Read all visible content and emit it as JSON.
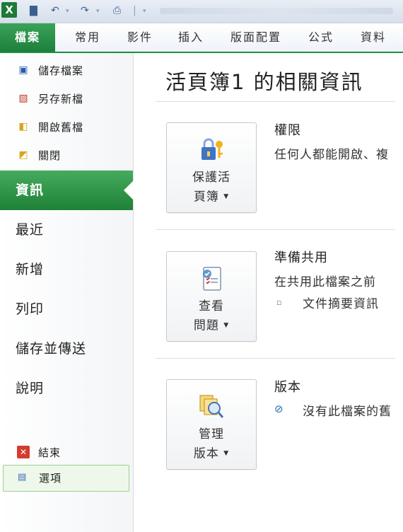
{
  "qat": {
    "logo": "X",
    "save_icon": "save-icon",
    "undo_icon": "undo-icon",
    "redo_icon": "redo-icon",
    "print_icon": "print-icon"
  },
  "tabs": [
    "檔案",
    "常用",
    "插入",
    "版面配置",
    "公式",
    "資料"
  ],
  "tabs_display": {
    "home": "常用",
    "insert": "插入",
    "layout": "版面配置",
    "formulas": "公式",
    "data": "資料",
    "file": "檔案",
    "extra": "影件"
  },
  "nav": {
    "commands": [
      {
        "label": "儲存檔案",
        "icon": "save-icon"
      },
      {
        "label": "另存新檔",
        "icon": "save-as-icon"
      },
      {
        "label": "開啟舊檔",
        "icon": "open-folder-icon"
      },
      {
        "label": "關閉",
        "icon": "close-folder-icon"
      }
    ],
    "items": [
      "資訊",
      "最近",
      "新增",
      "列印",
      "儲存並傳送",
      "說明"
    ],
    "selected": "資訊",
    "options": {
      "label": "選項",
      "icon": "options-icon"
    },
    "exit": {
      "label": "結束",
      "icon": "exit-icon"
    }
  },
  "main": {
    "title": "活頁簿1 的相關資訊",
    "sections": [
      {
        "button_line1": "保護活",
        "button_line2": "頁簿",
        "heading": "權限",
        "desc": "任何人都能開啟、複",
        "icon": "lock-key-icon"
      },
      {
        "button_line1": "查看",
        "button_line2": "問題",
        "heading": "準備共用",
        "desc": "在共用此檔案之前",
        "bullet": "文件摘要資訊",
        "icon": "checklist-icon"
      },
      {
        "button_line1": "管理",
        "button_line2": "版本",
        "heading": "版本",
        "desc": "沒有此檔案的舊",
        "icon": "versions-icon"
      }
    ]
  },
  "colors": {
    "accent": "#1e8136",
    "accent_light": "#46ab5e",
    "tab_bg": "#e9eef6"
  }
}
